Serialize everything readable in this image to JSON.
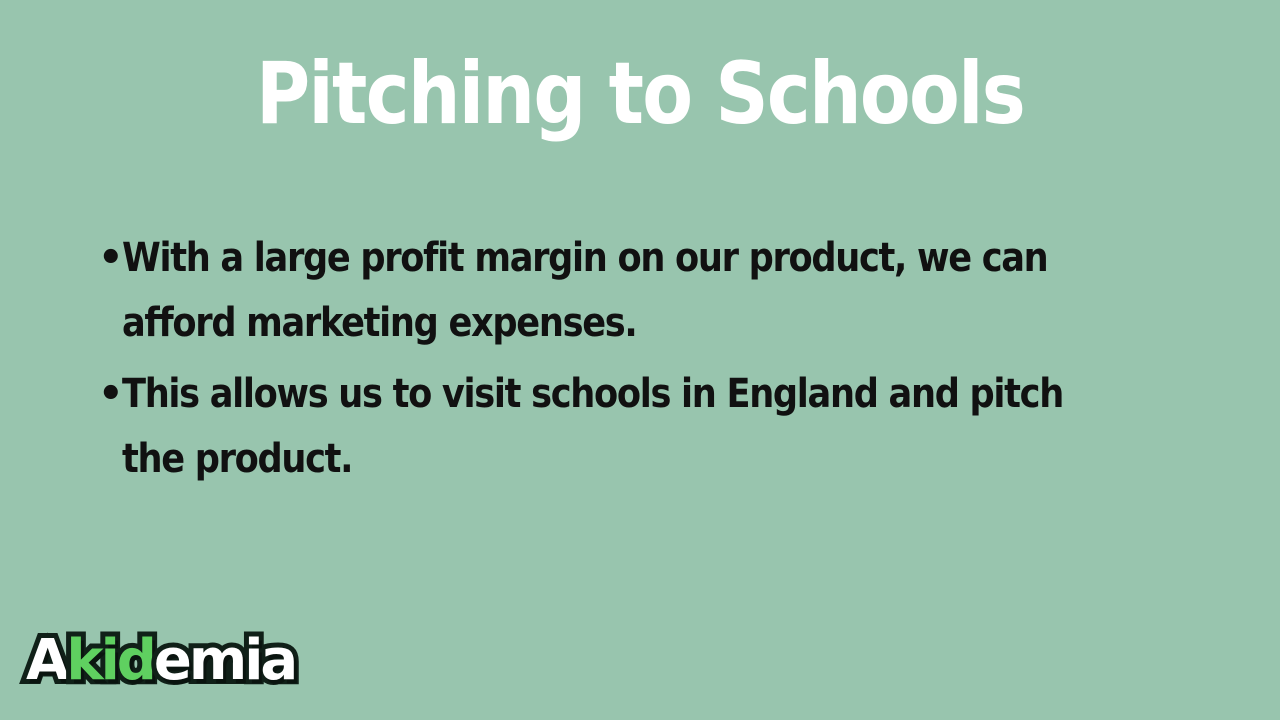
{
  "slide": {
    "title": "Pitching to Schools",
    "bullets": [
      {
        "marker": "•",
        "text": "With a large profit margin on our product, we can afford marketing expenses."
      },
      {
        "marker": "•",
        "text": "This allows us to visit schools in England and pitch the product."
      }
    ]
  },
  "logo": {
    "part1": "A",
    "part2": "kid",
    "part3": "emia"
  },
  "colors": {
    "background": "#98c5ae",
    "title": "#ffffff",
    "body_text": "#111111",
    "logo_accent": "#5fd060"
  }
}
